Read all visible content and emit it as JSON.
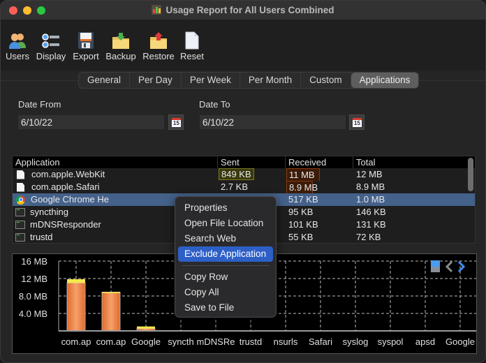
{
  "window": {
    "title": "Usage Report for All Users Combined"
  },
  "toolbar": {
    "items": [
      {
        "label": "Users",
        "icon": "users-icon"
      },
      {
        "label": "Display",
        "icon": "display-list-icon"
      },
      {
        "label": "Export",
        "icon": "floppy-disk-icon"
      },
      {
        "label": "Backup",
        "icon": "folder-download-icon"
      },
      {
        "label": "Restore",
        "icon": "folder-upload-icon"
      },
      {
        "label": "Reset",
        "icon": "blank-document-icon"
      }
    ]
  },
  "tabs": [
    {
      "label": "General",
      "active": false
    },
    {
      "label": "Per Day",
      "active": false
    },
    {
      "label": "Per Week",
      "active": false
    },
    {
      "label": "Per Month",
      "active": false
    },
    {
      "label": "Custom",
      "active": false
    },
    {
      "label": "Applications",
      "active": true
    }
  ],
  "date_from": {
    "label": "Date From",
    "value": "6/10/22"
  },
  "date_to": {
    "label": "Date To",
    "value": "6/10/22"
  },
  "calendar_icon_day": "15",
  "table": {
    "headers": [
      "Application",
      "Sent",
      "Received",
      "Total"
    ],
    "rows": [
      {
        "app": "com.apple.WebKit",
        "icon": "document-icon",
        "sent": "849 KB",
        "received": "11 MB",
        "total": "12 MB",
        "sent_hl": "yellow",
        "recv_hl": "orange"
      },
      {
        "app": "com.apple.Safari",
        "icon": "document-icon",
        "sent": "2.7 KB",
        "received": "8.9 MB",
        "total": "8.9 MB",
        "sent_hl": "",
        "recv_hl": "orange"
      },
      {
        "app": "Google Chrome He",
        "icon": "chrome-icon",
        "sent": "",
        "received": "517 KB",
        "total": "1.0 MB",
        "selected": true
      },
      {
        "app": "syncthing",
        "icon": "terminal-icon",
        "sent": "",
        "received": "95 KB",
        "total": "146 KB"
      },
      {
        "app": "mDNSResponder",
        "icon": "terminal-icon",
        "sent": "",
        "received": "101 KB",
        "total": "131 KB"
      },
      {
        "app": "trustd",
        "icon": "terminal-icon",
        "sent": "",
        "received": "55 KB",
        "total": "72 KB"
      }
    ]
  },
  "context_menu": {
    "items": [
      "Properties",
      "Open File Location",
      "Search Web",
      "Exclude Application"
    ],
    "highlighted": "Exclude Application",
    "items2": [
      "Copy Row",
      "Copy All",
      "Save to File"
    ]
  },
  "chart_data": {
    "type": "bar",
    "title": "",
    "xlabel": "",
    "ylabel": "",
    "categories": [
      "com.ap",
      "com.ap",
      "Google",
      "syncth",
      "mDNSRe",
      "trustd",
      "nsurls",
      "Safari",
      "syslog",
      "syspol",
      "apsd",
      "Google"
    ],
    "series": [
      {
        "name": "Received",
        "color": "#e8793a",
        "values": [
          11.0,
          8.9,
          0.517,
          0.095,
          0.101,
          0.055,
          0,
          0,
          0,
          0,
          0,
          0
        ]
      },
      {
        "name": "Sent",
        "color": "#f3e84a",
        "values": [
          0.849,
          0.0027,
          0.5,
          0.051,
          0.03,
          0.017,
          0,
          0,
          0,
          0,
          0,
          0
        ]
      }
    ],
    "y_ticks": [
      "4.0 MB",
      "8.0 MB",
      "12 MB",
      "16 MB"
    ],
    "y_tick_values": [
      4,
      8,
      12,
      16
    ],
    "ylim": [
      0,
      16
    ],
    "unit": "MB",
    "stacked": true,
    "grid": true
  },
  "chart_controls": {
    "icons": [
      "bar-chart-toggle-icon",
      "chevron-left-icon",
      "chevron-right-icon"
    ]
  }
}
